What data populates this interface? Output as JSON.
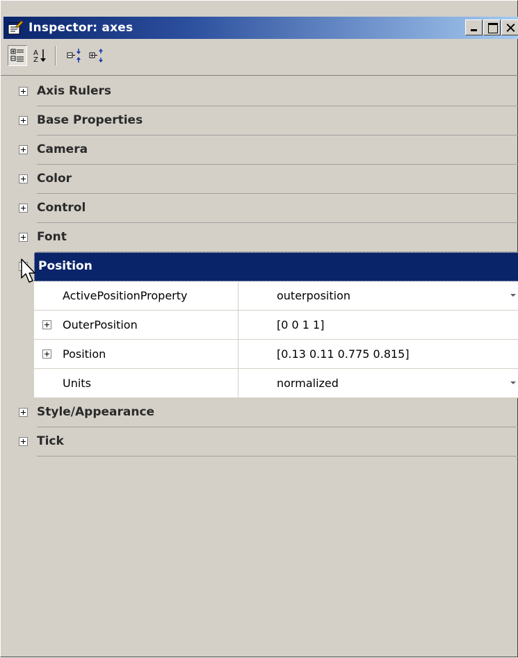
{
  "window": {
    "title": "Inspector: axes"
  },
  "toolbar": {
    "buttons": [
      {
        "name": "categorized-view",
        "icon": "categorized-icon",
        "pressed": true
      },
      {
        "name": "alphabetical-view",
        "icon": "sort-az-icon",
        "pressed": false
      },
      {
        "name": "expand-all",
        "icon": "expand-all-icon",
        "pressed": false
      },
      {
        "name": "collapse-all",
        "icon": "collapse-all-icon",
        "pressed": false
      }
    ]
  },
  "categories": [
    {
      "label": "Axis Rulers",
      "expanded": false
    },
    {
      "label": "Base Properties",
      "expanded": false
    },
    {
      "label": "Camera",
      "expanded": false
    },
    {
      "label": "Color",
      "expanded": false
    },
    {
      "label": "Control",
      "expanded": false
    },
    {
      "label": "Font",
      "expanded": false
    },
    {
      "label": "Position",
      "expanded": true,
      "selected": true
    },
    {
      "label": "Style/Appearance",
      "expanded": false
    },
    {
      "label": "Tick",
      "expanded": false
    }
  ],
  "position_properties": [
    {
      "name": "ActivePositionProperty",
      "value": "outerposition",
      "expandable": false,
      "dropdown": true
    },
    {
      "name": "OuterPosition",
      "value": "[0 0 1 1]",
      "expandable": true,
      "dropdown": false
    },
    {
      "name": "Position",
      "value": "[0.13 0.11 0.775 0.815]",
      "expandable": true,
      "dropdown": false
    },
    {
      "name": "Units",
      "value": "normalized",
      "expandable": false,
      "dropdown": true
    }
  ],
  "colors": {
    "selection": "#0a246a",
    "face": "#d4d0c8"
  }
}
